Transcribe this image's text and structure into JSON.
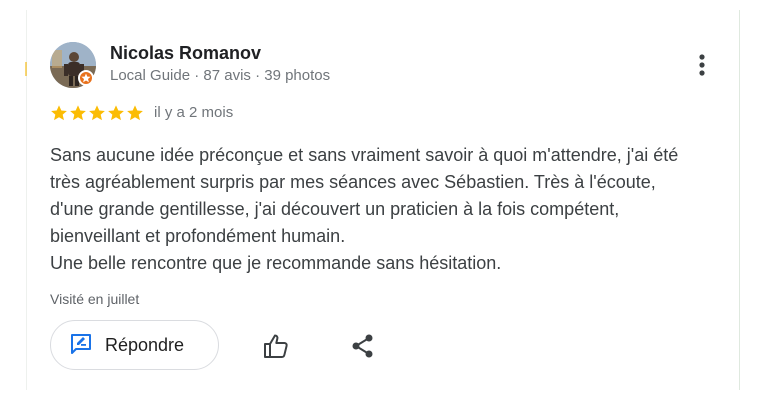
{
  "reviewer": {
    "name": "Nicolas Romanov",
    "meta": "Local Guide · 87 avis · 39 photos"
  },
  "rating": {
    "stars": 5,
    "max": 5,
    "color": "#fbbc04"
  },
  "date": "il y a 2 mois",
  "review_lines": [
    "Sans aucune idée préconçue et sans vraiment savoir à quoi m'attendre, j'ai été",
    "très agréablement surpris par mes séances avec Sébastien. Très à l'écoute,",
    "d'une grande gentillesse, j'ai découvert un praticien à la fois compétent,",
    "bienveillant et profondément humain.",
    "Une belle rencontre que je recommande sans hésitation."
  ],
  "visited": "Visité en juillet",
  "actions": {
    "reply_label": "Répondre",
    "reply_icon": "reply-edit-icon",
    "like_icon": "thumb-up-icon",
    "share_icon": "share-icon"
  },
  "colors": {
    "accent": "#1a73e8",
    "badge": "#e8711c"
  }
}
